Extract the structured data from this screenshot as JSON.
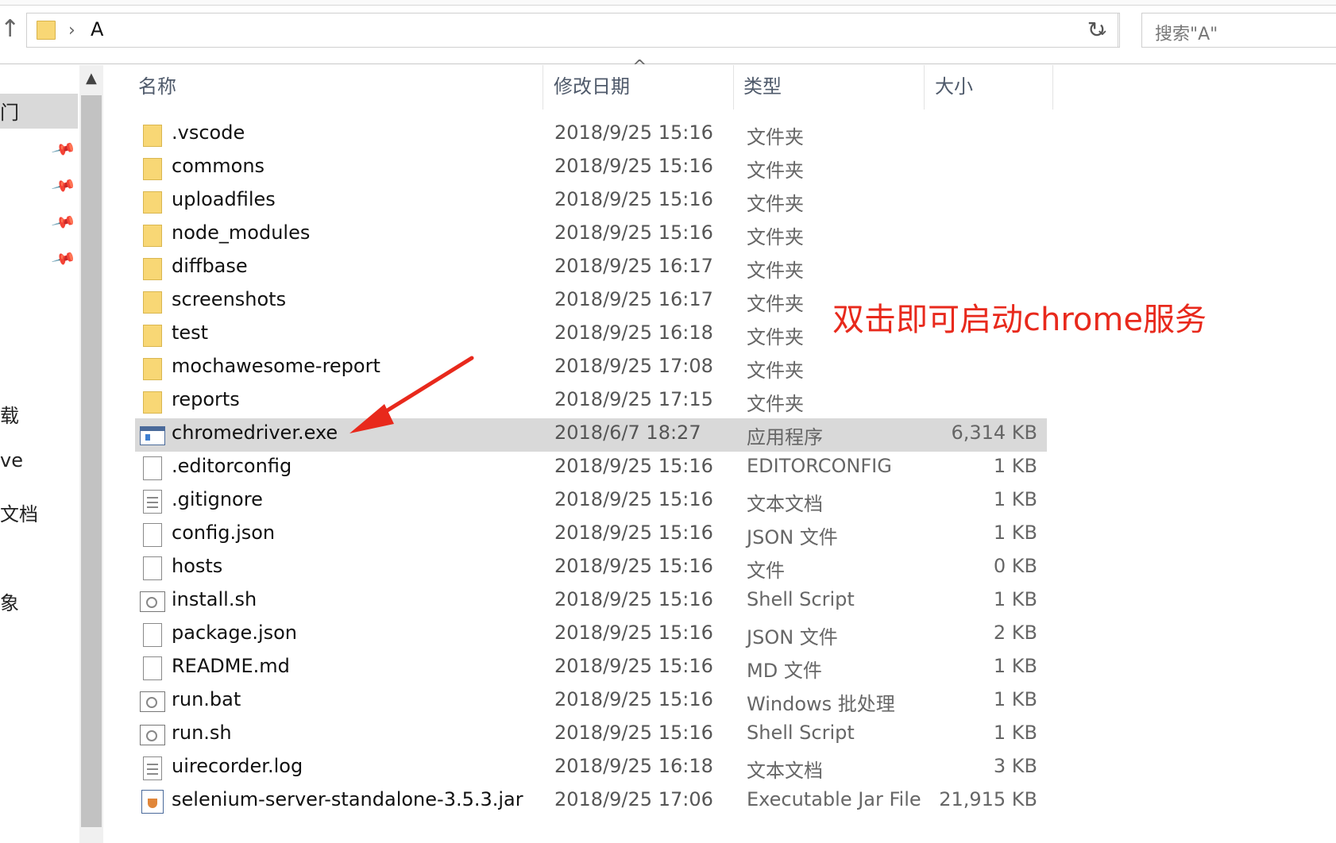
{
  "address_bar": {
    "up_arrow_icon": "up-arrow-icon",
    "chevron": "›",
    "path": "A",
    "refresh_glyph": "↻",
    "search_placeholder": "搜索\"A\""
  },
  "nav_pane": {
    "selected_label": "门",
    "items": [
      "载",
      "ve",
      "文档",
      "象"
    ]
  },
  "columns": {
    "name": "名称",
    "date": "修改日期",
    "type": "类型",
    "size": "大小"
  },
  "files": [
    {
      "name": ".vscode",
      "date": "2018/9/25 15:16",
      "type": "文件夹",
      "size": "",
      "icon": "folder-icon"
    },
    {
      "name": "commons",
      "date": "2018/9/25 15:16",
      "type": "文件夹",
      "size": "",
      "icon": "folder-icon"
    },
    {
      "name": "uploadfiles",
      "date": "2018/9/25 15:16",
      "type": "文件夹",
      "size": "",
      "icon": "folder-icon"
    },
    {
      "name": "node_modules",
      "date": "2018/9/25 15:16",
      "type": "文件夹",
      "size": "",
      "icon": "folder-icon"
    },
    {
      "name": "diffbase",
      "date": "2018/9/25 16:17",
      "type": "文件夹",
      "size": "",
      "icon": "folder-icon"
    },
    {
      "name": "screenshots",
      "date": "2018/9/25 16:17",
      "type": "文件夹",
      "size": "",
      "icon": "folder-icon"
    },
    {
      "name": "test",
      "date": "2018/9/25 16:18",
      "type": "文件夹",
      "size": "",
      "icon": "folder-icon"
    },
    {
      "name": "mochawesome-report",
      "date": "2018/9/25 17:08",
      "type": "文件夹",
      "size": "",
      "icon": "folder-icon"
    },
    {
      "name": "reports",
      "date": "2018/9/25 17:15",
      "type": "文件夹",
      "size": "",
      "icon": "folder-icon"
    },
    {
      "name": "chromedriver.exe",
      "date": "2018/6/7 18:27",
      "type": "应用程序",
      "size": "6,314 KB",
      "icon": "exe-icon"
    },
    {
      "name": ".editorconfig",
      "date": "2018/9/25 15:16",
      "type": "EDITORCONFIG",
      "size": "1 KB",
      "icon": "file-icon"
    },
    {
      "name": ".gitignore",
      "date": "2018/9/25 15:16",
      "type": "文本文档",
      "size": "1 KB",
      "icon": "text-file-icon"
    },
    {
      "name": "config.json",
      "date": "2018/9/25 15:16",
      "type": "JSON 文件",
      "size": "1 KB",
      "icon": "file-icon"
    },
    {
      "name": "hosts",
      "date": "2018/9/25 15:16",
      "type": "文件",
      "size": "0 KB",
      "icon": "file-icon"
    },
    {
      "name": "install.sh",
      "date": "2018/9/25 15:16",
      "type": "Shell Script",
      "size": "1 KB",
      "icon": "script-icon"
    },
    {
      "name": "package.json",
      "date": "2018/9/25 15:16",
      "type": "JSON 文件",
      "size": "2 KB",
      "icon": "file-icon"
    },
    {
      "name": "README.md",
      "date": "2018/9/25 15:16",
      "type": "MD 文件",
      "size": "1 KB",
      "icon": "file-icon"
    },
    {
      "name": "run.bat",
      "date": "2018/9/25 15:16",
      "type": "Windows 批处理",
      "size": "1 KB",
      "icon": "script-icon"
    },
    {
      "name": "run.sh",
      "date": "2018/9/25 15:16",
      "type": "Shell Script",
      "size": "1 KB",
      "icon": "script-icon"
    },
    {
      "name": "uirecorder.log",
      "date": "2018/9/25 16:18",
      "type": "文本文档",
      "size": "3 KB",
      "icon": "text-file-icon"
    },
    {
      "name": "selenium-server-standalone-3.5.3.jar",
      "date": "2018/9/25 17:06",
      "type": "Executable Jar File",
      "size": "21,915 KB",
      "icon": "jar-icon"
    }
  ],
  "selected_file": "chromedriver.exe",
  "annotation": {
    "text": "双击即可启动chrome服务",
    "color": "#e8291c"
  }
}
